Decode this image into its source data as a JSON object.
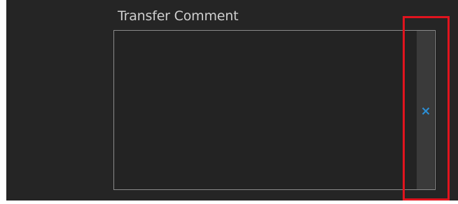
{
  "transfer_comment": {
    "label": "Transfer Comment",
    "value": "",
    "clear_button": {
      "icon": "close-icon",
      "color": "#2b8fd6"
    }
  },
  "annotation": {
    "highlight_color": "#e0141e"
  }
}
